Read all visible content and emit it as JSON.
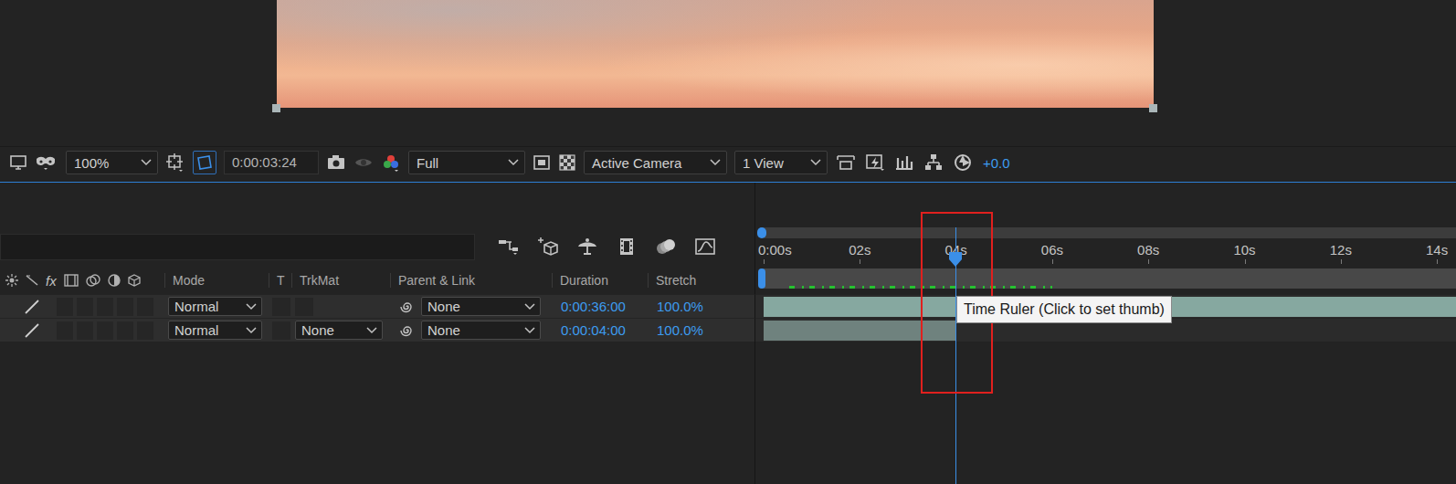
{
  "toolbar": {
    "zoom": "100%",
    "timecode": "0:00:03:24",
    "resolution": "Full",
    "view": "Active Camera",
    "layout": "1 View",
    "exposure": "+0.0",
    "region_of_interest": true
  },
  "timeline": {
    "header": {
      "switches_label": "fx",
      "columns": [
        "Mode",
        "T",
        "TrkMat",
        "Parent & Link",
        "Duration",
        "Stretch"
      ]
    },
    "ruler": {
      "ticks": [
        "0:00s",
        "02s",
        "04s",
        "06s",
        "08s",
        "10s",
        "12s",
        "14s"
      ],
      "playhead_level": 0.277,
      "cache_level": 0.38
    },
    "layers": [
      {
        "mode": "Normal",
        "trkmat": "",
        "parent": "None",
        "duration": "0:00:36:00",
        "stretch": "100.0%",
        "bar_level": 1,
        "color": "#86a8a0"
      },
      {
        "mode": "Normal",
        "trkmat": "None",
        "parent": "None",
        "duration": "0:00:04:00",
        "stretch": "100.0%",
        "bar_level": 0.277,
        "color": "#6f827e"
      }
    ],
    "tooltip": "Time Ruler (Click to set thumb)"
  }
}
